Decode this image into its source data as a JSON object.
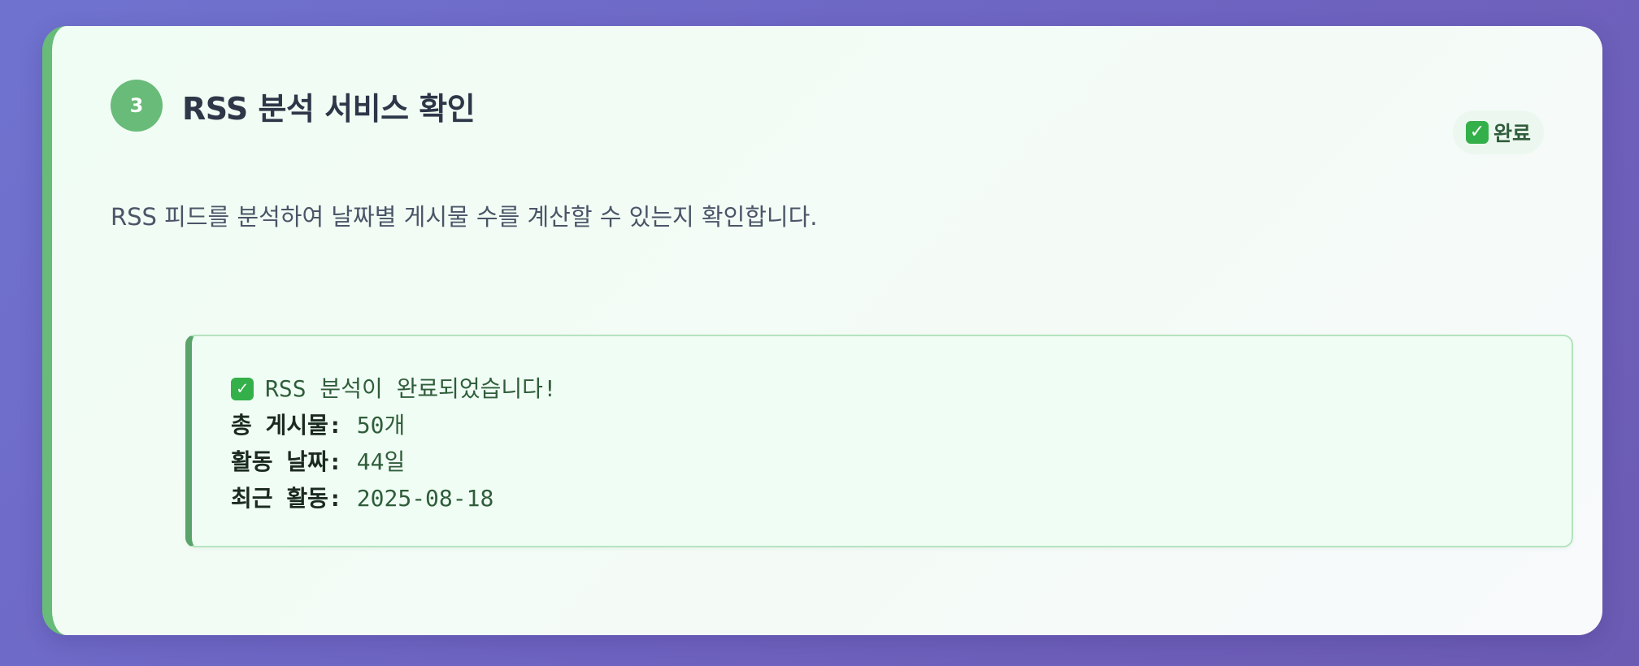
{
  "step": {
    "number": "3",
    "title": "RSS 분석 서비스 확인",
    "status": "완료",
    "description": "RSS 피드를 분석하여 날짜별 게시물 수를 계산할 수 있는지 확인합니다."
  },
  "result": {
    "message": "RSS 분석이 완료되었습니다!",
    "items": [
      {
        "label": "총 게시물:",
        "value": "50개"
      },
      {
        "label": "활동 날짜:",
        "value": "44일"
      },
      {
        "label": "최근 활동:",
        "value": "2025-08-18"
      }
    ]
  },
  "icons": {
    "status": "check-box-icon",
    "result": "check-box-icon"
  },
  "colors": {
    "accent": "#68bb78",
    "background_gradient_start": "#6f73cf",
    "background_gradient_end": "#6c5bb3",
    "result_text": "#2f5d3a"
  }
}
